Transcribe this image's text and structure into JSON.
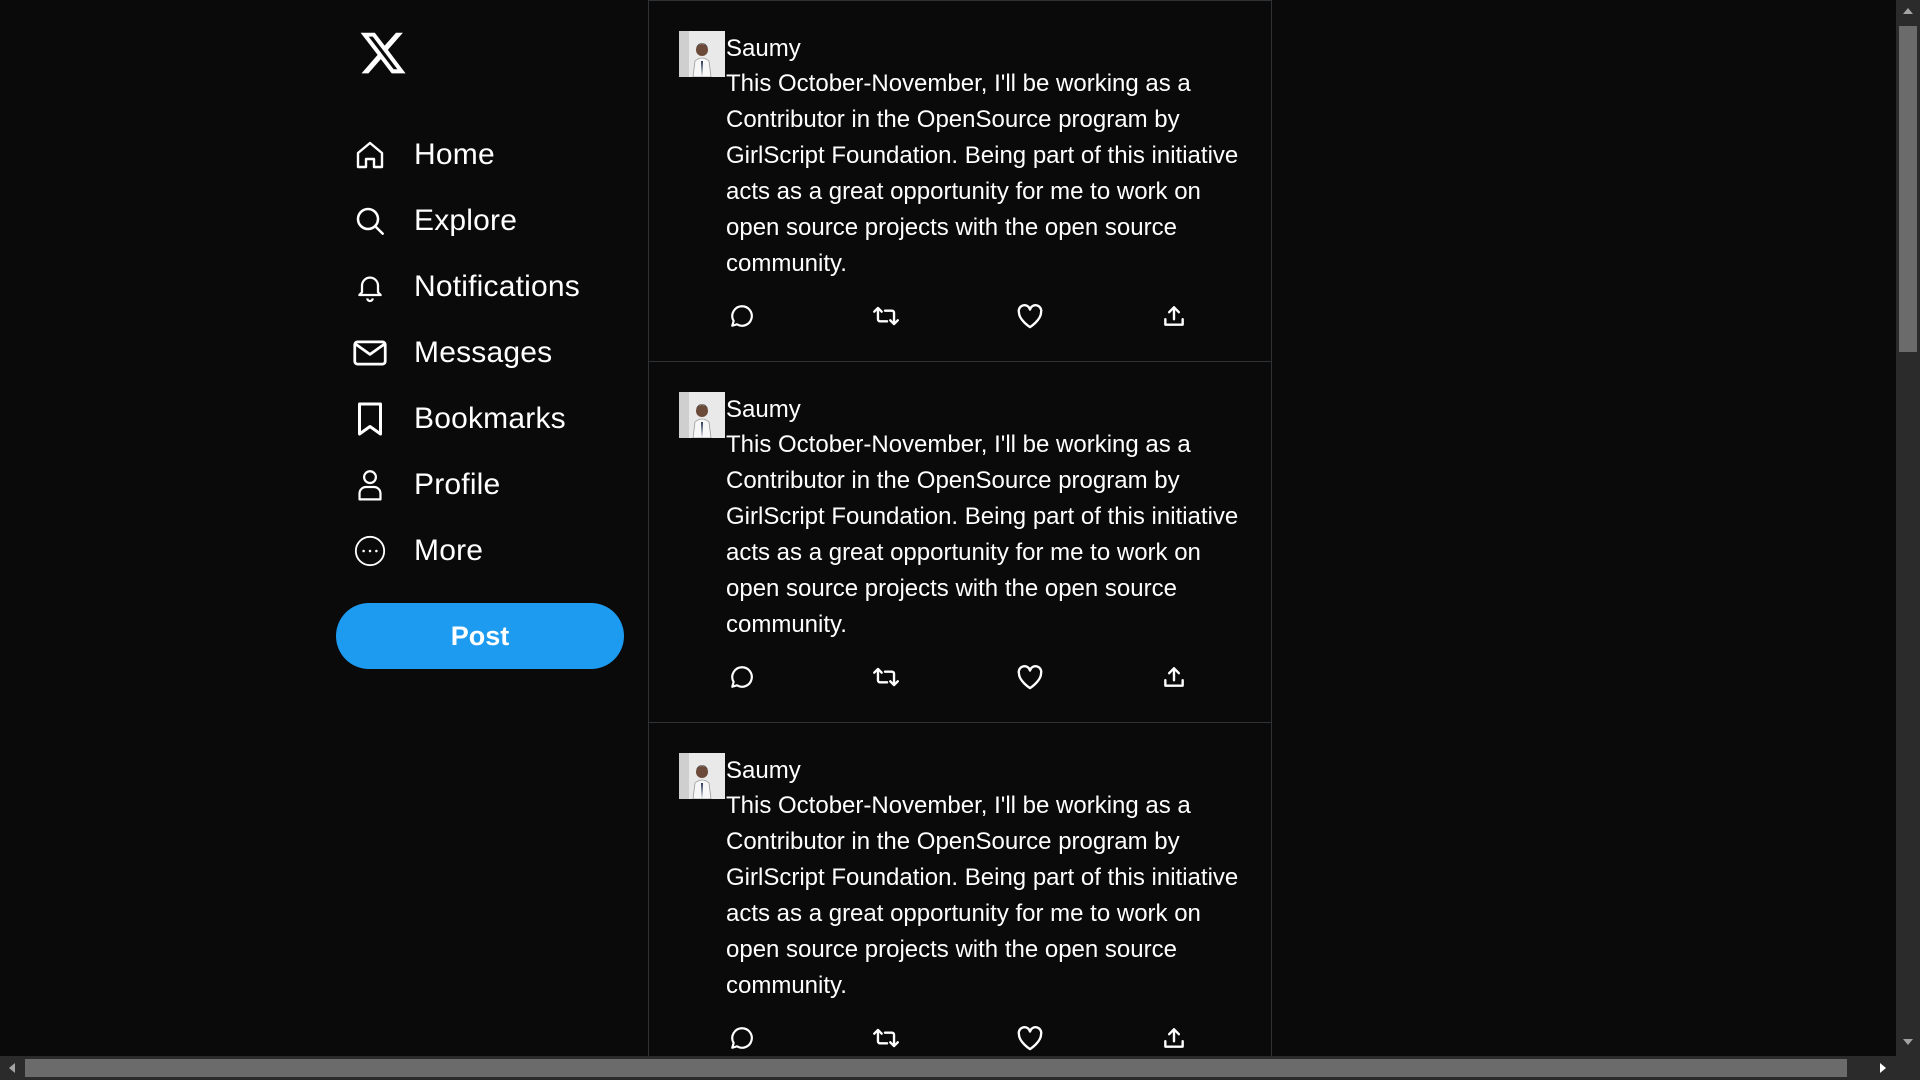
{
  "app": {
    "logo_icon": "x-logo-icon"
  },
  "sidebar": {
    "items": [
      {
        "label": "Home",
        "icon": "home-icon"
      },
      {
        "label": "Explore",
        "icon": "search-icon"
      },
      {
        "label": "Notifications",
        "icon": "bell-icon"
      },
      {
        "label": "Messages",
        "icon": "mail-icon"
      },
      {
        "label": "Bookmarks",
        "icon": "bookmark-icon"
      },
      {
        "label": "Profile",
        "icon": "person-icon"
      },
      {
        "label": "More",
        "icon": "more-circle-icon"
      }
    ],
    "post_label": "Post"
  },
  "feed": {
    "tweets": [
      {
        "author": "Saumy",
        "text": "This October-November, I'll be working as a Contributor in the OpenSource program by GirlScript Foundation. Being part of this initiative acts as a great opportunity for me to work on open source projects with the open source community."
      },
      {
        "author": "Saumy",
        "text": "This October-November, I'll be working as a Contributor in the OpenSource program by GirlScript Foundation. Being part of this initiative acts as a great opportunity for me to work on open source projects with the open source community."
      },
      {
        "author": "Saumy",
        "text": "This October-November, I'll be working as a Contributor in the OpenSource program by GirlScript Foundation. Being part of this initiative acts as a great opportunity for me to work on open source projects with the open source community."
      }
    ],
    "action_icons": [
      "reply-icon",
      "retweet-icon",
      "like-icon",
      "share-icon"
    ]
  },
  "theme": {
    "background": "#0a0a0a",
    "accent": "#1d9bf0",
    "border": "#2f3336",
    "text": "#ffffff"
  }
}
